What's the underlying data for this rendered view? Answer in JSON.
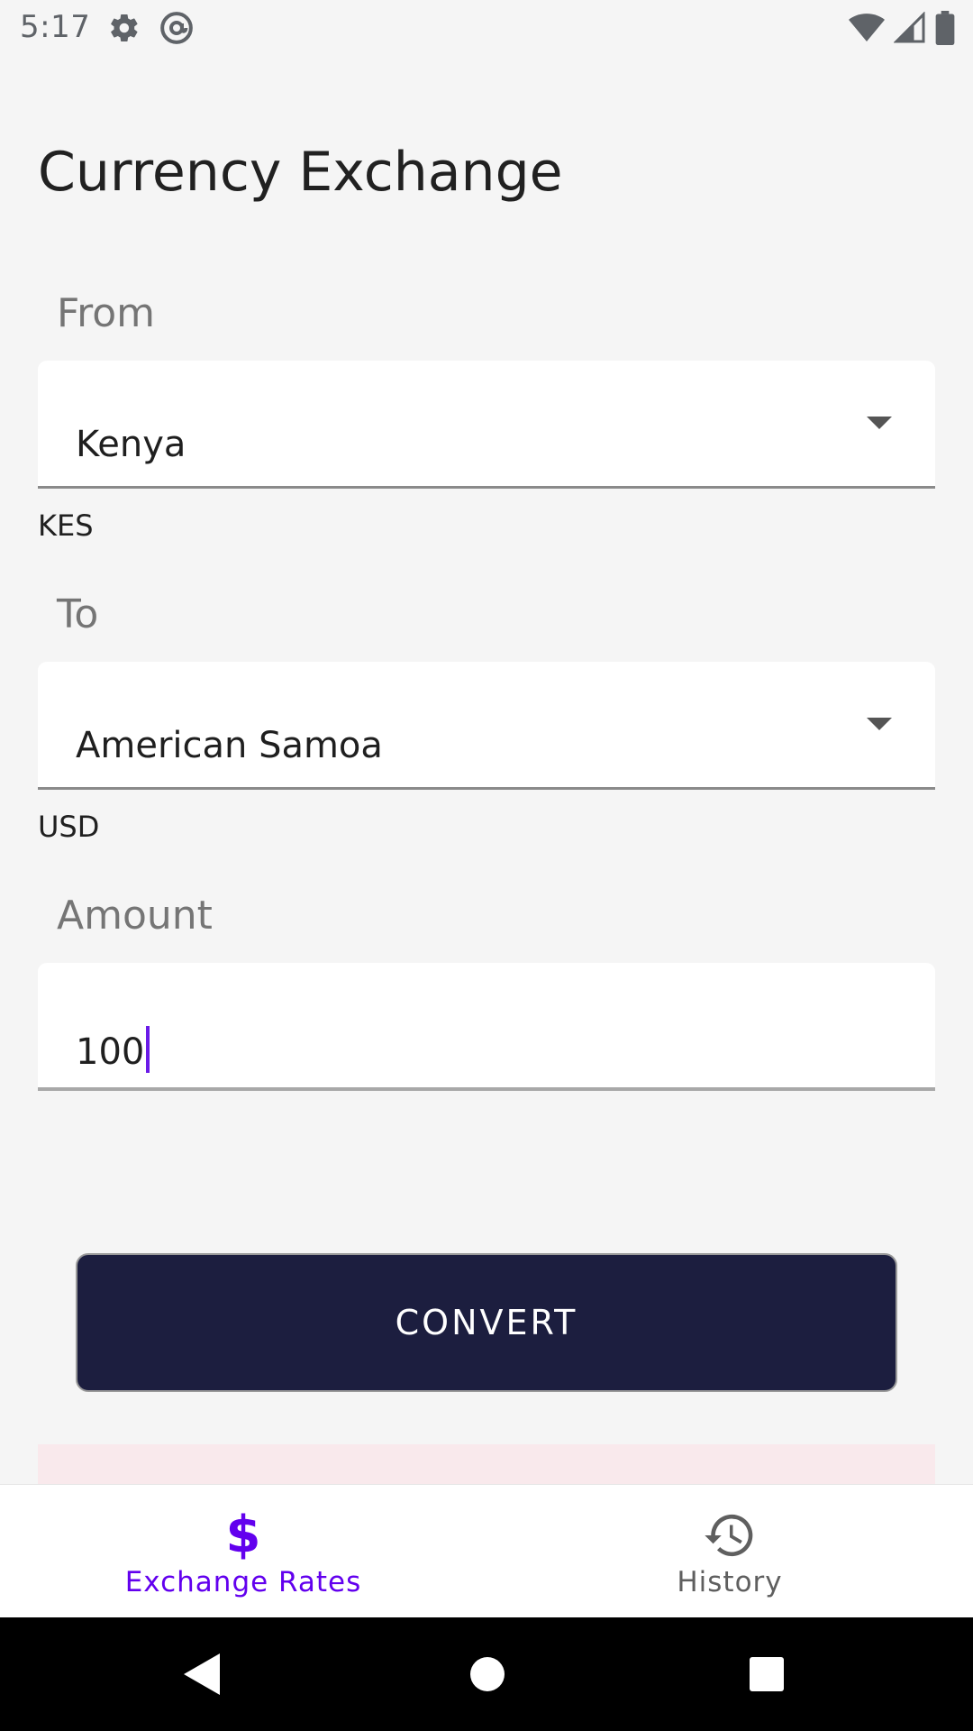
{
  "status": {
    "time": "5:17",
    "icons": [
      "gear-icon",
      "at-sign-icon",
      "wifi-icon",
      "cellular-icon",
      "battery-icon"
    ]
  },
  "page": {
    "title": "Currency Exchange"
  },
  "from": {
    "label": "From",
    "selected": "Kenya",
    "code": "KES"
  },
  "to": {
    "label": "To",
    "selected": "American Samoa",
    "code": "USD"
  },
  "amount": {
    "label": "Amount",
    "value": "100"
  },
  "convert": {
    "label": "CONVERT"
  },
  "nav": {
    "items": [
      {
        "label": "Exchange Rates",
        "icon": "dollar-icon",
        "active": true
      },
      {
        "label": "History",
        "icon": "history-icon",
        "active": false
      }
    ]
  },
  "colors": {
    "accent": "#6200ee",
    "button": "#1c1e3f",
    "background": "#f5f5f5",
    "result_strip": "#f9e9ec"
  }
}
